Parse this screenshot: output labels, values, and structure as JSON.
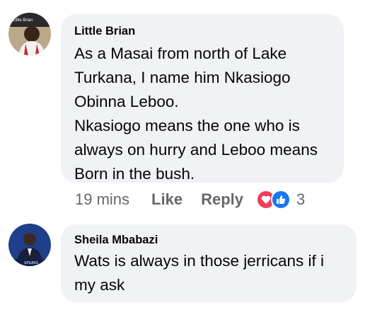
{
  "comments": [
    {
      "author": "Little Brian",
      "text": "As a Masai from north of Lake\nTurkana, I name him Nkasiogo\nObinna Leboo.\nNkasiogo means the one who is\nalways on hurry and Leboo means\nBorn in the bush.",
      "avatar_text": "Little Brian",
      "time": "19 mins",
      "like_label": "Like",
      "reply_label": "Reply",
      "reaction_icons": [
        "love-icon",
        "like-icon"
      ],
      "reaction_count": "3"
    },
    {
      "author": "Sheila Mbabazi",
      "text": "Wats is always in those jerricans if i\nmy ask",
      "avatar_text": "SPEAKS"
    }
  ],
  "colors": {
    "bubble": "#f0f2f5",
    "meta_text": "#65676b",
    "love": "#f33e58",
    "like": "#1877f2"
  }
}
